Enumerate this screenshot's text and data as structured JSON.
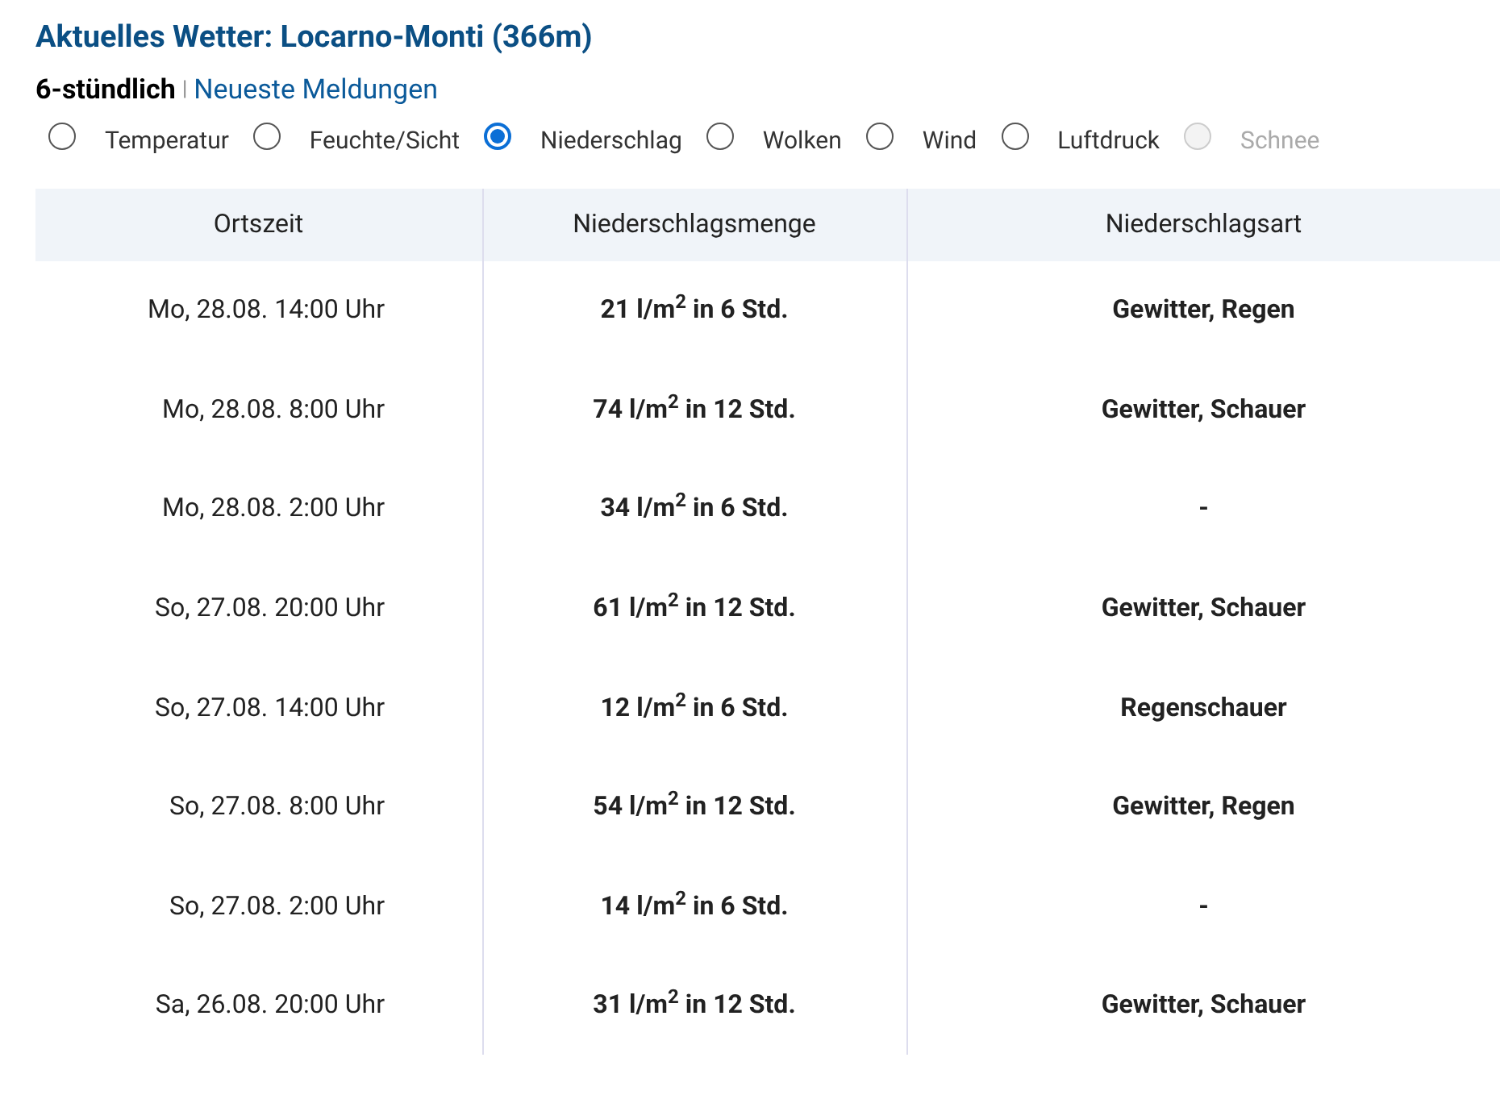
{
  "title": "Aktuelles Wetter: Locarno-Monti (366m)",
  "subnav": [
    {
      "label": "6-stündlich",
      "selected": true
    },
    {
      "label": "Neueste Meldungen",
      "selected": false
    }
  ],
  "separator": "|",
  "radios": [
    {
      "label": "Temperatur",
      "selected": false,
      "disabled": false
    },
    {
      "label": "Feuchte/Sicht",
      "selected": false,
      "disabled": false
    },
    {
      "label": "Niederschlag",
      "selected": true,
      "disabled": false
    },
    {
      "label": "Wolken",
      "selected": false,
      "disabled": false
    },
    {
      "label": "Wind",
      "selected": false,
      "disabled": false
    },
    {
      "label": "Luftdruck",
      "selected": false,
      "disabled": false
    },
    {
      "label": "Schnee",
      "selected": false,
      "disabled": true
    }
  ],
  "table": {
    "columns": [
      "Ortszeit",
      "Niederschlagsmenge",
      "Niederschlagsart"
    ],
    "rows": [
      [
        "Mo, 28.08. 14:00 Uhr",
        "21 l/m$^{2}$ in 6 Std.",
        "Gewitter, Regen"
      ],
      [
        "Mo, 28.08. 8:00 Uhr",
        "74 l/m$^{2}$ in 12 Std.",
        "Gewitter, Schauer"
      ],
      [
        "Mo, 28.08. 2:00 Uhr",
        "34 l/m$^{2}$ in 6 Std.",
        "-"
      ],
      [
        "So, 27.08. 20:00 Uhr",
        "61 l/m$^{2}$ in 12 Std.",
        "Gewitter, Schauer"
      ],
      [
        "So, 27.08. 14:00 Uhr",
        "12 l/m$^{2}$ in 6 Std.",
        "Regenschauer"
      ],
      [
        "So, 27.08. 8:00 Uhr",
        "54 l/m$^{2}$ in 12 Std.",
        "Gewitter, Regen"
      ],
      [
        "So, 27.08. 2:00 Uhr",
        "14 l/m$^{2}$ in 6 Std.",
        "-"
      ],
      [
        "Sa, 26.08. 20:00 Uhr",
        "31 l/m$^{2}$ in 12 Std.",
        "Gewitter, Schauer"
      ]
    ]
  }
}
